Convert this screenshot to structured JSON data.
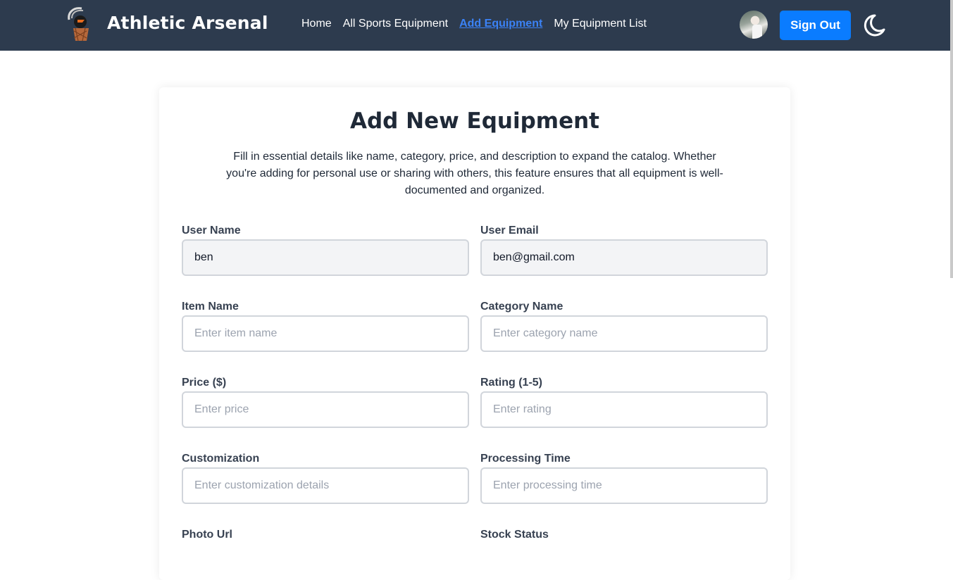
{
  "navbar": {
    "brand": "Athletic Arsenal",
    "links": [
      {
        "label": "Home",
        "active": false
      },
      {
        "label": "All Sports Equipment",
        "active": false
      },
      {
        "label": "Add Equipment",
        "active": true
      },
      {
        "label": "My Equipment List",
        "active": false
      }
    ],
    "sign_out_label": "Sign Out",
    "theme_icon": "moon-icon",
    "logo_icon": "basketball-logo-icon"
  },
  "form": {
    "title": "Add New Equipment",
    "description": "Fill in essential details like name, category, price, and description to expand the catalog. Whether you're adding for personal use or sharing with others, this feature ensures that all equipment is well-documented and organized.",
    "fields": {
      "user_name": {
        "label": "User Name",
        "value": "ben",
        "placeholder": ""
      },
      "user_email": {
        "label": "User Email",
        "value": "ben@gmail.com",
        "placeholder": ""
      },
      "item_name": {
        "label": "Item Name",
        "value": "",
        "placeholder": "Enter item name"
      },
      "category_name": {
        "label": "Category Name",
        "value": "",
        "placeholder": "Enter category name"
      },
      "price": {
        "label": "Price ($)",
        "value": "",
        "placeholder": "Enter price"
      },
      "rating": {
        "label": "Rating (1-5)",
        "value": "",
        "placeholder": "Enter rating"
      },
      "customization": {
        "label": "Customization",
        "value": "",
        "placeholder": "Enter customization details"
      },
      "processing_time": {
        "label": "Processing Time",
        "value": "",
        "placeholder": "Enter processing time"
      },
      "photo_url": {
        "label": "Photo Url"
      },
      "stock_status": {
        "label": "Stock Status"
      }
    }
  },
  "colors": {
    "navbar_bg": "#2d3b4e",
    "accent": "#0a7cff",
    "active_link": "#3b82f6"
  }
}
